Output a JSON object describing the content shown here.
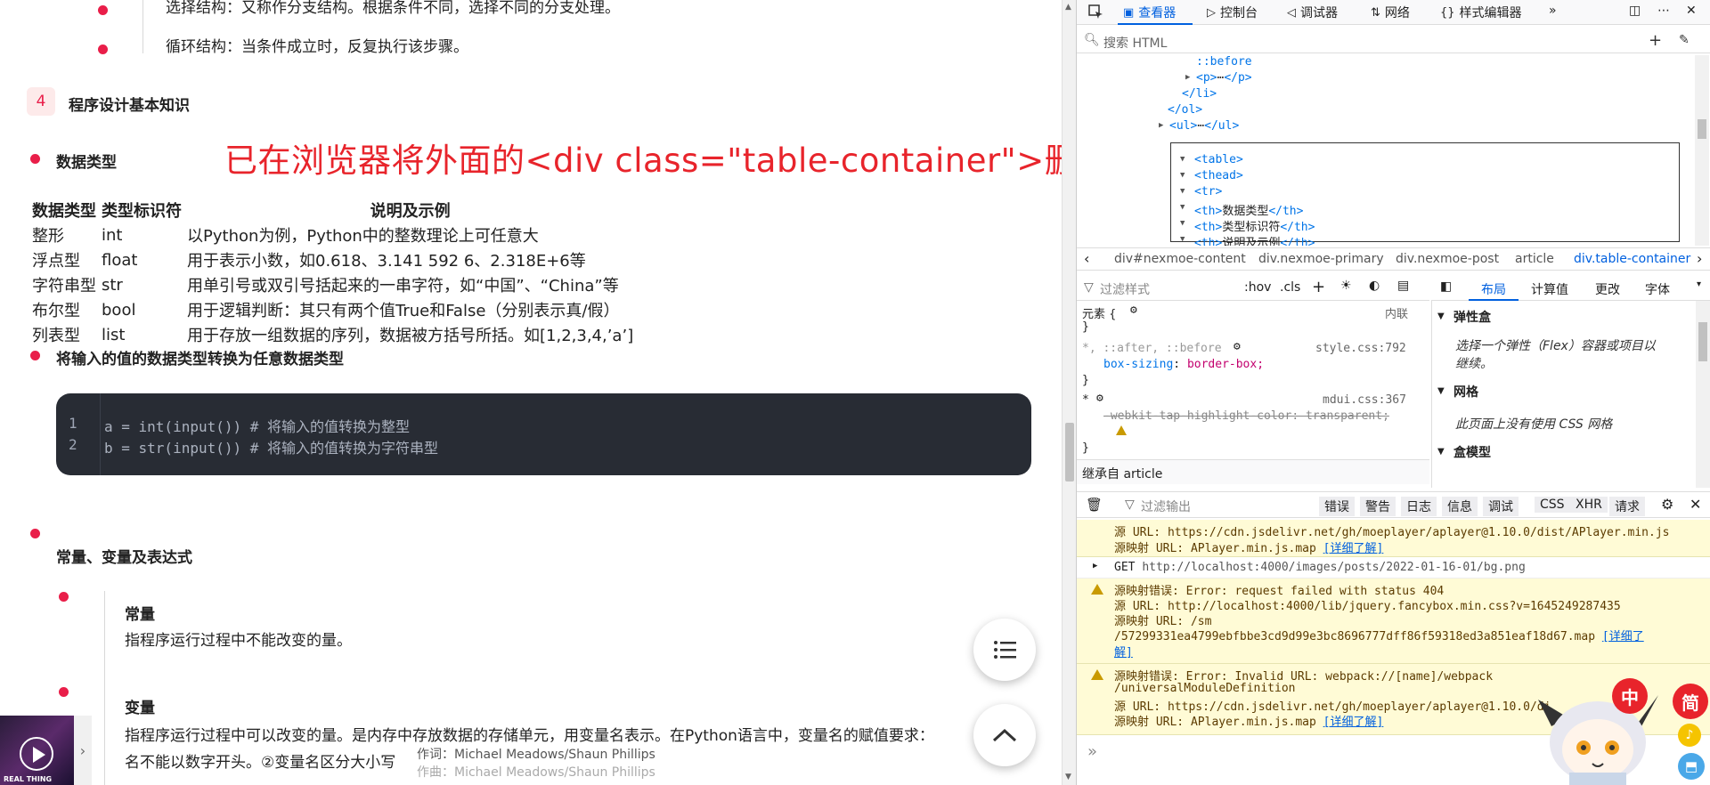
{
  "page": {
    "top_item_1": "选择结构：又称作分支结构。根据条件不同，选择不同的分支处理。",
    "top_item_2": "循环结构：当条件成立时，反复执行该步骤。",
    "section_number": "4",
    "section_title": "程序设计基本知识",
    "data_types_heading": "数据类型",
    "annotation": "已在浏览器将外面的<div class=\"table-container\">删除",
    "table": {
      "headers": [
        "数据类型",
        "类型标识符",
        "说明及示例"
      ],
      "rows": [
        [
          "整形",
          "int",
          "以Python为例，Python中的整数理论上可任意大"
        ],
        [
          "浮点型",
          "float",
          "用于表示小数，如0.618、3.141 592 6、2.318E+6等"
        ],
        [
          "字符串型",
          "str",
          "用单引号或双引号括起来的一串字符，如“中国”、“China”等"
        ],
        [
          "布尔型",
          "bool",
          "用于逻辑判断：其只有两个值True和False（分别表示真/假）"
        ],
        [
          "列表型",
          "list",
          "用于存放一组数据的序列，数据被方括号所括。如[1,2,3,4,’a’]"
        ]
      ]
    },
    "convert_heading": "将输入的值的数据类型转换为任意数据类型",
    "code": {
      "lines": [
        {
          "no": "1",
          "text": "a = int(input()) # 将输入的值转换为整型"
        },
        {
          "no": "2",
          "text": "b = str(input()) # 将输入的值转换为字符串型"
        }
      ]
    },
    "const_heading": "常量、变量及表达式",
    "const_title": "常量",
    "const_desc": "指程序运行过程中不能改变的量。",
    "var_title": "变量",
    "var_desc_1": "指程序运行过程中可以改变的量。是内存中存放数据的存储单元，用变量名表示。在Python语言中，变量名的赋值要求：",
    "var_desc_2": "名不能以数字开头。②变量名区分大小写",
    "player": {
      "cover_label": "REAL THING",
      "lyric_1": "作词：Michael Meadows/Shaun Phillips",
      "lyric_2": "作曲：Michael Meadows/Shaun Phillips"
    }
  },
  "devtools": {
    "tabs": [
      "查看器",
      "控制台",
      "调试器",
      "网络",
      "样式编辑器"
    ],
    "search_placeholder": "搜索 HTML",
    "markup": {
      "before": "::before",
      "p_open": "<p>",
      "p_close": "</p>",
      "li_close": "</li>",
      "ol_close": "</ol>",
      "ul_open": "<ul>",
      "ul_close": "</ul>",
      "table": "<table>",
      "thead": "<thead>",
      "tr": "<tr>",
      "th1_open": "<th>",
      "th1_text": "数据类型",
      "th1_close": "</th>",
      "th2_open": "<th>",
      "th2_text": "类型标识符",
      "th2_close": "</th>",
      "th3_open": "<th>",
      "th3_text": "说明及示例",
      "th3_close": "</th>",
      "ellipsis": "⋯"
    },
    "breadcrumbs": [
      "div#nexmoe-content",
      "div.nexmoe-primary",
      "div.nexmoe-post",
      "article",
      "div.table-container"
    ],
    "rules_filter": "过滤样式",
    "rules_buttons": [
      ":hov",
      ".cls"
    ],
    "rules": {
      "element": "元素 {",
      "element_src": "内联",
      "close": "}",
      "sel1": "*, ::after, ::before",
      "src1": "style.css:792",
      "prop1": "box-sizing",
      "val1": "border-box;",
      "sel2": "*",
      "src2": "mdui.css:367",
      "prop2": "-webkit-tap-highlight-color: transparent;",
      "inherited": "继承自 article"
    },
    "layout_tabs": [
      "布局",
      "计算值",
      "更改",
      "字体"
    ],
    "layout": {
      "flex_title": "弹性盒",
      "flex_desc_1": "选择一个弹性（Flex）容器或项目以",
      "flex_desc_2": "继续。",
      "grid_title": "网格",
      "grid_desc": "此页面上没有使用 CSS 网格",
      "box_title": "盒模型"
    },
    "console_filter": "过滤输出",
    "console_filters": [
      "错误",
      "警告",
      "日志",
      "信息",
      "调试",
      "CSS",
      "XHR",
      "请求"
    ],
    "console_msgs": {
      "m1_l1": "源 URL: https://cdn.jsdelivr.net/gh/moeplayer/aplayer@1.10.0/dist/APlayer.min.js",
      "m1_l2": "源映射 URL: APlayer.min.js.map",
      "learn_more": "[详细了解]",
      "get_method": "GET",
      "get_url": "http://localhost:4000/images/posts/2022-01-16-01/bg.png",
      "m3_l1": "源映射错误: Error: request failed with status 404",
      "m3_l2": "源 URL: http://localhost:4000/lib/jquery.fancybox.min.css?v=1645249287435",
      "m3_l3": "源映射 URL: /sm",
      "m3_l4": "/57299331ea4799ebfbbe3cd9d99e3bc8696777dff86f59318ed3a851eaf18d67.map",
      "m3_l5_link": "[详细了",
      "m3_l6_link": "解]",
      "m4_l1": "源映射错误: Error: Invalid URL: webpack://[name]/webpack",
      "m4_l2": "/universalModuleDefinition",
      "m4_l3": "源 URL: https://cdn.jsdelivr.net/gh/moeplayer/aplayer@1.10.0/di",
      "m4_l4": "源映射 URL: APlayer.min.js.map"
    },
    "prompt": "»"
  },
  "overlay": {
    "badge_zh": "中",
    "badge_jian": "简"
  },
  "colors": {
    "accent_pink": "#e91e49",
    "annotation_red": "#e8242b",
    "devtools_blue": "#0060df",
    "warn_bg": "#fffbd6",
    "code_bg": "#282c34"
  }
}
